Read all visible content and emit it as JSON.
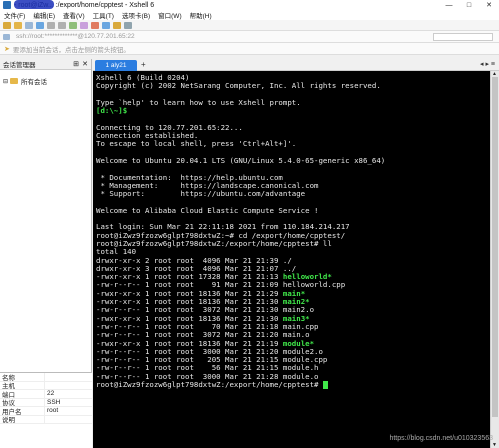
{
  "window": {
    "title": "- root@iZw... :/export/home/cpptest - Xshell 6",
    "controls": [
      "—",
      "□",
      "✕"
    ]
  },
  "menu": [
    "文件(F)",
    "编辑(E)",
    "查看(V)",
    "工具(T)",
    "选项卡(B)",
    "窗口(W)",
    "帮助(H)"
  ],
  "address": "ssh://root:*************@120.77.201.65:22",
  "info_hint": "要添加当前会话，点击左侧的箭头按钮。",
  "sidebar": {
    "title": "会话管理器",
    "tree": [
      {
        "label": "所有会话"
      }
    ],
    "properties": [
      {
        "key": "名称",
        "value": ""
      },
      {
        "key": "主机",
        "value": ""
      },
      {
        "key": "端口",
        "value": "22"
      },
      {
        "key": "协议",
        "value": "SSH"
      },
      {
        "key": "用户名",
        "value": "root"
      },
      {
        "key": "说明",
        "value": ""
      }
    ]
  },
  "tabs": [
    {
      "label": "1 aly21",
      "active": true
    }
  ],
  "terminal": {
    "lines": [
      {
        "text": "Xshell 6 (Build 0204)"
      },
      {
        "text": "Copyright (c) 2002 NetSarang Computer, Inc. All rights reserved."
      },
      {
        "text": ""
      },
      {
        "text": "Type `help' to learn how to use Xshell prompt."
      },
      {
        "text": "[d:\\~]$",
        "green": true
      },
      {
        "text": ""
      },
      {
        "text": "Connecting to 120.77.201.65:22..."
      },
      {
        "text": "Connection established."
      },
      {
        "text": "To escape to local shell, press 'Ctrl+Alt+]'."
      },
      {
        "text": ""
      },
      {
        "text": "Welcome to Ubuntu 20.04.1 LTS (GNU/Linux 5.4.0-65-generic x86_64)"
      },
      {
        "text": ""
      },
      {
        "text": " * Documentation:  https://help.ubuntu.com"
      },
      {
        "text": " * Management:     https://landscape.canonical.com"
      },
      {
        "text": " * Support:        https://ubuntu.com/advantage"
      },
      {
        "text": ""
      },
      {
        "text": "Welcome to Alibaba Cloud Elastic Compute Service !"
      },
      {
        "text": ""
      },
      {
        "text": "Last login: Sun Mar 21 22:11:18 2021 from 110.184.214.217"
      },
      {
        "text": "root@iZwz9fzozw6glpt798dxtwZ:~# cd /export/home/cpptest/"
      },
      {
        "text": "root@iZwz9fzozw6glpt798dxtwZ:/export/home/cpptest# ll"
      },
      {
        "text": "total 140"
      },
      {
        "text": "drwxr-xr-x 2 root root  4096 Mar 21 21:39 ./"
      },
      {
        "text": "drwxr-xr-x 3 root root  4096 Mar 21 21:07 ../"
      },
      {
        "prefix": "-rwxr-xr-x 1 root root 17328 Mar 21 21:13 ",
        "name": "helloworld*"
      },
      {
        "text": "-rw-r--r-- 1 root root    91 Mar 21 21:09 helloworld.cpp"
      },
      {
        "prefix": "-rwxr-xr-x 1 root root 18136 Mar 21 21:29 ",
        "name": "main*"
      },
      {
        "prefix": "-rwxr-xr-x 1 root root 18136 Mar 21 21:30 ",
        "name": "main2*"
      },
      {
        "text": "-rw-r--r-- 1 root root  3072 Mar 21 21:30 main2.o"
      },
      {
        "prefix": "-rwxr-xr-x 1 root root 18136 Mar 21 21:30 ",
        "name": "main3*"
      },
      {
        "text": "-rw-r--r-- 1 root root    70 Mar 21 21:18 main.cpp"
      },
      {
        "text": "-rw-r--r-- 1 root root  3072 Mar 21 21:20 main.o"
      },
      {
        "prefix": "-rwxr-xr-x 1 root root 18136 Mar 21 21:19 ",
        "name": "module*"
      },
      {
        "text": "-rw-r--r-- 1 root root  3000 Mar 21 21:20 module2.o"
      },
      {
        "text": "-rw-r--r-- 1 root root   205 Mar 21 21:15 module.cpp"
      },
      {
        "text": "-rw-r--r-- 1 root root    56 Mar 21 21:15 module.h"
      },
      {
        "text": "-rw-r--r-- 1 root root  3000 Mar 21 21:28 module.o"
      },
      {
        "text": "root@iZwz9fzozw6glpt798dxtwZ:/export/home/cpptest# ",
        "cursor": true
      }
    ]
  },
  "watermark": "https://blog.csdn.net/u010323563",
  "colors": {
    "accent": "#2b7de0",
    "terminal_bg": "#000000",
    "exec_green": "#40e84a"
  }
}
